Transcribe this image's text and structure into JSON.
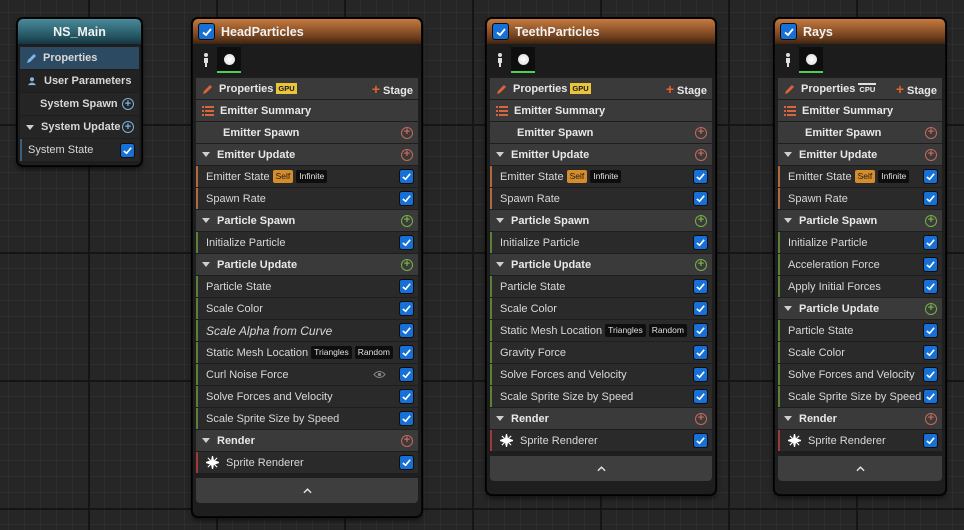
{
  "ns_main": {
    "title": "NS_Main",
    "items": [
      {
        "label": "Properties"
      },
      {
        "label": "User Parameters"
      },
      {
        "label": "System Spawn"
      },
      {
        "label": "System Update"
      },
      {
        "label": "System State"
      }
    ]
  },
  "emitters": [
    {
      "title": "HeadParticles",
      "properties_label": "Properties",
      "sim_target": "GPU",
      "stage_label": "Stage",
      "summary_label": "Emitter Summary",
      "sections": [
        {
          "label": "Emitter Spawn",
          "modules": []
        },
        {
          "label": "Emitter Update",
          "modules": [
            {
              "label": "Emitter State",
              "badges": [
                "Self",
                "Infinite"
              ]
            },
            {
              "label": "Spawn Rate"
            }
          ]
        },
        {
          "label": "Particle Spawn",
          "modules": [
            {
              "label": "Initialize Particle"
            }
          ]
        },
        {
          "label": "Particle Update",
          "modules": [
            {
              "label": "Particle State"
            },
            {
              "label": "Scale Color"
            },
            {
              "label": "Scale Alpha from Curve"
            },
            {
              "label": "Static Mesh Location",
              "badges": [
                "Triangles",
                "Random"
              ]
            },
            {
              "label": "Curl Noise Force"
            },
            {
              "label": "Solve Forces and Velocity"
            },
            {
              "label": "Scale Sprite Size by Speed"
            }
          ]
        },
        {
          "label": "Render",
          "modules": [
            {
              "label": "Sprite Renderer"
            }
          ]
        }
      ]
    },
    {
      "title": "TeethParticles",
      "properties_label": "Properties",
      "sim_target": "GPU",
      "stage_label": "Stage",
      "summary_label": "Emitter Summary",
      "sections": [
        {
          "label": "Emitter Spawn",
          "modules": []
        },
        {
          "label": "Emitter Update",
          "modules": [
            {
              "label": "Emitter State",
              "badges": [
                "Self",
                "Infinite"
              ]
            },
            {
              "label": "Spawn Rate"
            }
          ]
        },
        {
          "label": "Particle Spawn",
          "modules": [
            {
              "label": "Initialize Particle"
            }
          ]
        },
        {
          "label": "Particle Update",
          "modules": [
            {
              "label": "Particle State"
            },
            {
              "label": "Scale Color"
            },
            {
              "label": "Static Mesh Location",
              "badges": [
                "Triangles",
                "Random"
              ]
            },
            {
              "label": "Gravity Force"
            },
            {
              "label": "Solve Forces and Velocity"
            },
            {
              "label": "Scale Sprite Size by Speed"
            }
          ]
        },
        {
          "label": "Render",
          "modules": [
            {
              "label": "Sprite Renderer"
            }
          ]
        }
      ]
    },
    {
      "title": "Rays",
      "properties_label": "Properties",
      "sim_target": "CPU",
      "stage_label": "Stage",
      "summary_label": "Emitter Summary",
      "sections": [
        {
          "label": "Emitter Spawn",
          "modules": []
        },
        {
          "label": "Emitter Update",
          "modules": [
            {
              "label": "Emitter State",
              "badges": [
                "Self",
                "Infinite"
              ]
            },
            {
              "label": "Spawn Rate"
            }
          ]
        },
        {
          "label": "Particle Spawn",
          "modules": [
            {
              "label": "Initialize Particle"
            },
            {
              "label": "Acceleration Force"
            },
            {
              "label": "Apply Initial Forces"
            }
          ]
        },
        {
          "label": "Particle Update",
          "modules": [
            {
              "label": "Particle State"
            },
            {
              "label": "Scale Color"
            },
            {
              "label": "Solve Forces and Velocity"
            },
            {
              "label": "Scale Sprite Size by Speed"
            }
          ]
        },
        {
          "label": "Render",
          "modules": [
            {
              "label": "Sprite Renderer"
            }
          ]
        }
      ]
    }
  ],
  "colors": {
    "accent_blue": "#1670d6",
    "emitter_header": "#c77a3f",
    "system_header": "#4a8a9a",
    "spawn_green": "#78b048",
    "update_orange": "#b06a3c",
    "render_red": "#9e3a3a"
  }
}
